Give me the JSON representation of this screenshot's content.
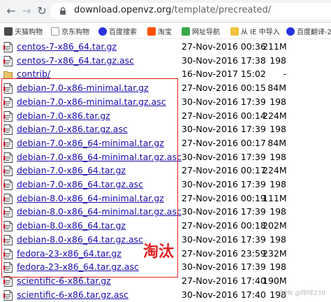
{
  "browser": {
    "url_host": "download.openvz.org",
    "url_path": "/template/precreated/"
  },
  "bookmarks": [
    {
      "label": "天猫购物",
      "icon": "grid-icon"
    },
    {
      "label": "京东购物",
      "icon": "jd-icon"
    },
    {
      "label": "百度搜索",
      "icon": "baidu-icon"
    },
    {
      "label": "淘宝",
      "icon": "taobao-icon"
    },
    {
      "label": "网址导航",
      "icon": "nav-icon"
    },
    {
      "label": "从 IE 中导入",
      "icon": "folder-icon"
    },
    {
      "label": "百度翻译-2",
      "icon": "baidu-icon"
    }
  ],
  "files": [
    {
      "name": "centos-7-x86_64.tar.gz",
      "date": "27-Nov-2016 00:36",
      "size": "211M",
      "type": "file"
    },
    {
      "name": "centos-7-x86_64.tar.gz.asc",
      "date": "30-Nov-2016 17:38",
      "size": "198",
      "type": "file"
    },
    {
      "name": "contrib/",
      "date": "16-Nov-2017 15:02",
      "size": "-",
      "type": "folder"
    },
    {
      "name": "debian-7.0-x86-minimal.tar.gz",
      "date": "27-Nov-2016 00:15",
      "size": "84M",
      "type": "file"
    },
    {
      "name": "debian-7.0-x86-minimal.tar.gz.asc",
      "date": "30-Nov-2016 17:39",
      "size": "198",
      "type": "file"
    },
    {
      "name": "debian-7.0-x86.tar.gz",
      "date": "27-Nov-2016 00:14",
      "size": "224M",
      "type": "file"
    },
    {
      "name": "debian-7.0-x86.tar.gz.asc",
      "date": "30-Nov-2016 17:39",
      "size": "198",
      "type": "file"
    },
    {
      "name": "debian-7.0-x86_64-minimal.tar.gz",
      "date": "27-Nov-2016 00:17",
      "size": "84M",
      "type": "file"
    },
    {
      "name": "debian-7.0-x86_64-minimal.tar.gz.asc",
      "date": "30-Nov-2016 17:39",
      "size": "198",
      "type": "file"
    },
    {
      "name": "debian-7.0-x86_64.tar.gz",
      "date": "27-Nov-2016 00:17",
      "size": "224M",
      "type": "file"
    },
    {
      "name": "debian-7.0-x86_64.tar.gz.asc",
      "date": "30-Nov-2016 17:39",
      "size": "198",
      "type": "file"
    },
    {
      "name": "debian-8.0-x86_64-minimal.tar.gz",
      "date": "27-Nov-2016 00:19",
      "size": "111M",
      "type": "file"
    },
    {
      "name": "debian-8.0-x86_64-minimal.tar.gz.asc",
      "date": "30-Nov-2016 17:39",
      "size": "198",
      "type": "file"
    },
    {
      "name": "debian-8.0-x86_64.tar.gz",
      "date": "27-Nov-2016 00:18",
      "size": "202M",
      "type": "file"
    },
    {
      "name": "debian-8.0-x86_64.tar.gz.asc",
      "date": "30-Nov-2016 17:39",
      "size": "198",
      "type": "file"
    },
    {
      "name": "fedora-23-x86_64.tar.gz",
      "date": "27-Nov-2016 23:59",
      "size": "232M",
      "type": "file"
    },
    {
      "name": "fedora-23-x86_64.tar.gz.asc",
      "date": "30-Nov-2016 17:39",
      "size": "198",
      "type": "file"
    },
    {
      "name": "scientific-6-x86.tar.gz",
      "date": "27-Nov-2016 17:40",
      "size": "190M",
      "type": "file"
    },
    {
      "name": "scientific-6-x86.tar.gz.asc",
      "date": "30-Nov-2016 17:40",
      "size": "198",
      "type": "file"
    }
  ],
  "annotation": "淘汰",
  "watermark": "CSDN @咩咩230",
  "colors": {
    "highlight_box": "#e02020",
    "link": "#1a0dab"
  }
}
